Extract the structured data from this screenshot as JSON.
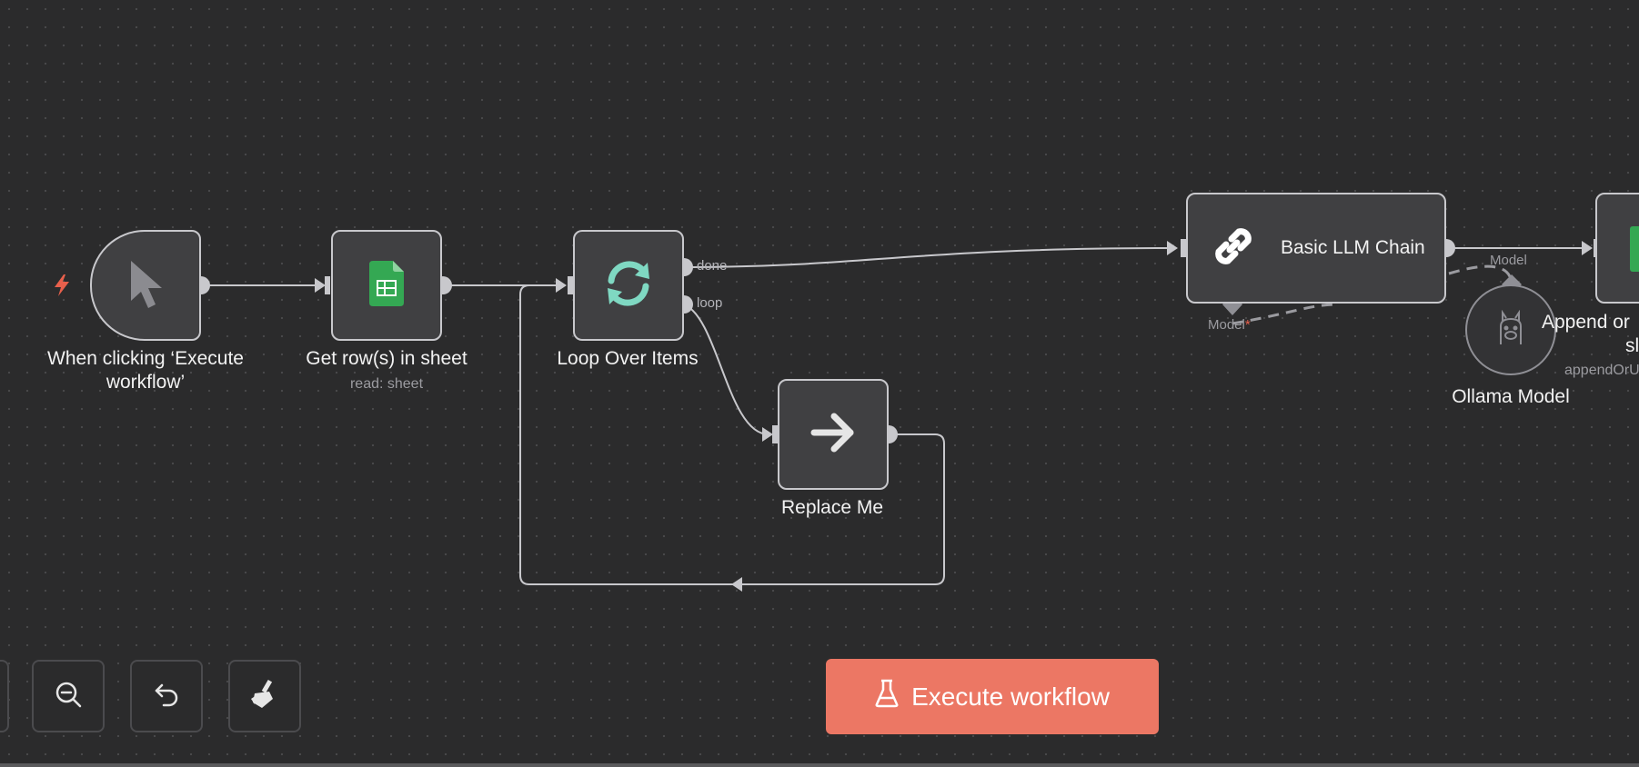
{
  "nodes": {
    "trigger": {
      "label_line1": "When clicking ‘Execute",
      "label_line2": "workflow’",
      "icon": "cursor-icon"
    },
    "sheets": {
      "label": "Get row(s) in sheet",
      "subtitle": "read: sheet",
      "icon": "google-sheets-icon"
    },
    "loop": {
      "label": "Loop Over Items",
      "output_done": "done",
      "output_loop": "loop",
      "icon": "refresh-icon"
    },
    "replace": {
      "label": "Replace Me",
      "icon": "arrow-right-icon"
    },
    "llm_chain": {
      "label": "Basic LLM Chain",
      "model_port": "Model",
      "required_marker": "*",
      "icon": "link-icon"
    },
    "ollama": {
      "label": "Ollama Model",
      "model_port": "Model",
      "icon": "llama-icon"
    },
    "append": {
      "label_line1": "Append or",
      "label_line2": "sl",
      "subtitle": "appendOrU"
    }
  },
  "toolbar": {
    "zoom_out": "zoom-out-icon",
    "undo": "undo-icon",
    "clear": "broom-icon"
  },
  "execute_button": {
    "label": "Execute workflow",
    "icon": "flask-icon"
  },
  "colors": {
    "canvas": "#2b2b2c",
    "node_bg": "#404042",
    "node_border": "#c8c8cc",
    "accent": "#ec7764",
    "sheets_green": "#34a853",
    "loop_teal": "#7fd8c2",
    "trigger_bolt": "#e8604c"
  }
}
